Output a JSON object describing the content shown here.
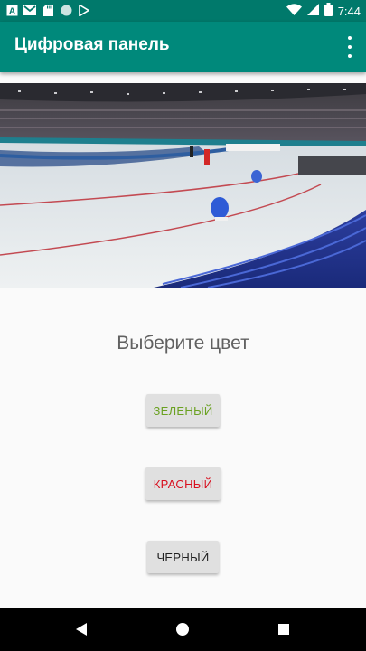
{
  "status_bar": {
    "time": "7:44",
    "left_icons": [
      "text-a-icon",
      "gmail-icon",
      "sd-card-icon",
      "circle-icon",
      "play-store-icon"
    ],
    "right_icons": [
      "wifi-icon",
      "signal-icon",
      "battery-icon"
    ]
  },
  "app_bar": {
    "title": "Цифровая панель",
    "menu_icon": "more-vert-icon",
    "color": "#00897b",
    "status_color": "#00796b"
  },
  "hero_image": {
    "subject": "speed skating arena photo"
  },
  "main": {
    "prompt": "Выберите цвет",
    "buttons": [
      {
        "label": "Зеленый",
        "color": "#6aa121"
      },
      {
        "label": "Красный",
        "color": "#d80f1e"
      },
      {
        "label": "Черный",
        "color": "#212121"
      }
    ]
  },
  "nav_bar": {
    "icons": [
      "back-icon",
      "home-icon",
      "recents-icon"
    ]
  }
}
